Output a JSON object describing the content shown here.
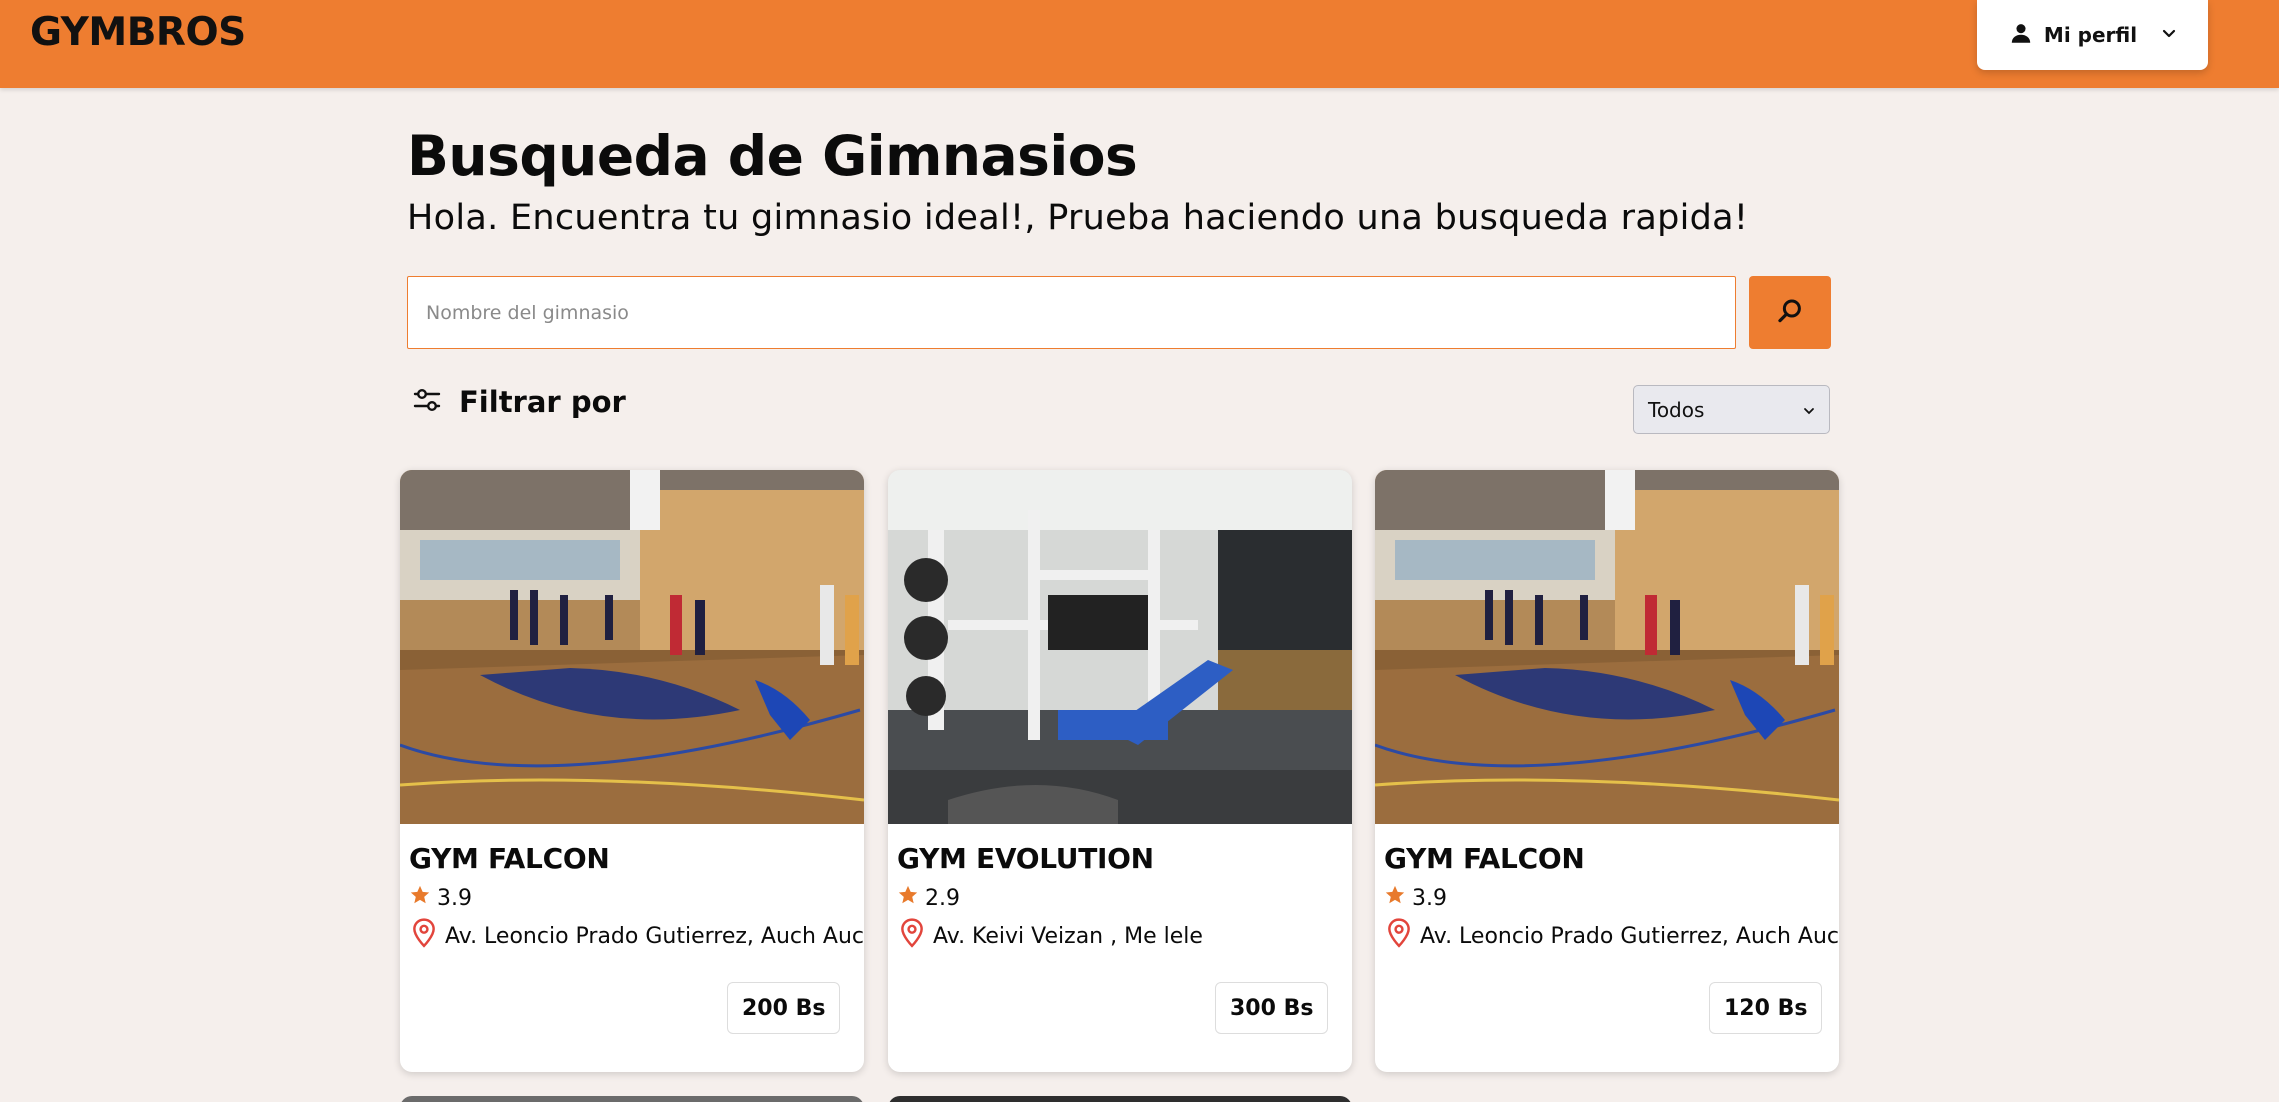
{
  "header": {
    "brand": "GYMBROS",
    "profile_label": "Mi perfil",
    "profile_icon": "user-icon",
    "dropdown_icon": "chevron-down-icon",
    "bg_color": "#ee7d30"
  },
  "main": {
    "title": "Busqueda de Gimnasios",
    "subtitle": "Hola. Encuentra tu gimnasio ideal!, Prueba haciendo una busqueda rapida!",
    "search": {
      "placeholder": "Nombre del gimnasio",
      "value": "",
      "button_icon": "search-icon"
    },
    "filter": {
      "label": "Filtrar por",
      "icon": "sliders-icon",
      "selected": "Todos"
    }
  },
  "gyms": [
    {
      "name": "GYM FALCON",
      "rating": "3.9",
      "address": "Av. Leoncio Prado Gutierrez, Auch Auch",
      "price": "200 Bs",
      "photo": "basketball-court-photo"
    },
    {
      "name": "GYM EVOLUTION",
      "rating": "2.9",
      "address": "Av. Keivi Veizan , Me lele",
      "price": "300 Bs",
      "photo": "gym-machines-photo"
    },
    {
      "name": "GYM FALCON",
      "rating": "3.9",
      "address": "Av. Leoncio Prado Gutierrez, Auch Auch",
      "price": "120 Bs",
      "photo": "basketball-court-photo"
    }
  ],
  "colors": {
    "accent": "#ee7d30",
    "star": "#e87a2c",
    "pin": "#e2453c",
    "page_bg": "#f5efec"
  }
}
